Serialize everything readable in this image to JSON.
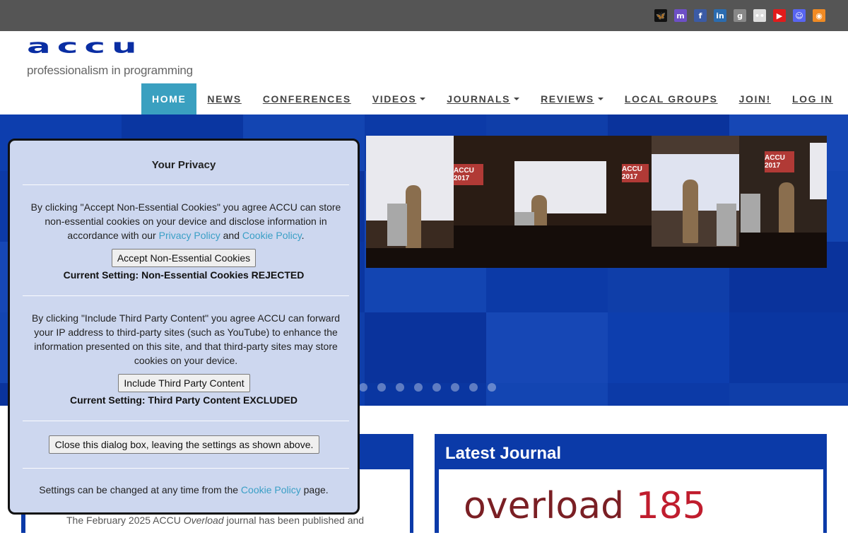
{
  "social": {
    "icons": [
      {
        "name": "bluesky-icon",
        "glyph": "🦋",
        "color": "#111111"
      },
      {
        "name": "mastodon-icon",
        "glyph": "m",
        "color": "#6d4fc6"
      },
      {
        "name": "facebook-icon",
        "glyph": "f",
        "color": "#3b5ba5"
      },
      {
        "name": "linkedin-icon",
        "glyph": "in",
        "color": "#2b6cb0"
      },
      {
        "name": "goodreads-icon",
        "glyph": "g",
        "color": "#888888"
      },
      {
        "name": "flickr-icon",
        "glyph": "••",
        "color": "#dddddd"
      },
      {
        "name": "youtube-icon",
        "glyph": "▶",
        "color": "#e21b1b"
      },
      {
        "name": "discord-icon",
        "glyph": "☺",
        "color": "#5865f2"
      },
      {
        "name": "rss-icon",
        "glyph": "◉",
        "color": "#f08a24"
      }
    ]
  },
  "brand": {
    "logo": "accu",
    "tagline": "professionalism in programming"
  },
  "nav": {
    "items": [
      {
        "label": "HOME",
        "active": true,
        "dropdown": false
      },
      {
        "label": "NEWS",
        "active": false,
        "dropdown": false
      },
      {
        "label": "CONFERENCES",
        "active": false,
        "dropdown": false
      },
      {
        "label": "VIDEOS",
        "active": false,
        "dropdown": true
      },
      {
        "label": "JOURNALS",
        "active": false,
        "dropdown": true
      },
      {
        "label": "REVIEWS",
        "active": false,
        "dropdown": true
      },
      {
        "label": "LOCAL GROUPS",
        "active": false,
        "dropdown": false
      },
      {
        "label": "JOIN!",
        "active": false,
        "dropdown": false
      },
      {
        "label": "LOG IN",
        "active": false,
        "dropdown": false
      }
    ]
  },
  "hero": {
    "sign_text": "ACCU 2017",
    "carousel_dot_count": 8
  },
  "privacy": {
    "title": "Your Privacy",
    "cookies_text_before": "By clicking \"Accept Non-Essential Cookies\" you agree ACCU can store non-essential cookies on your device and disclose information in accordance with our ",
    "privacy_policy_link": "Privacy Policy",
    "and_text": " and ",
    "cookie_policy_link": "Cookie Policy",
    "period": ".",
    "accept_button": "Accept Non-Essential Cookies",
    "cookies_setting": "Current Setting: Non-Essential Cookies REJECTED",
    "third_party_text": "By clicking \"Include Third Party Content\" you agree ACCU can forward your IP address to third-party sites (such as YouTube) to enhance the information presented on this site, and that third-party sites may store cookies on your device.",
    "include_button": "Include Third Party Content",
    "third_party_setting": "Current Setting: Third Party Content EXCLUDED",
    "close_button": "Close this dialog box, leaving the settings as shown above.",
    "footer_before": "Settings can be changed at any time from the ",
    "footer_link": "Cookie Policy",
    "footer_after": " page."
  },
  "news_panel": {
    "snippet_before": "The February 2025 ACCU ",
    "snippet_italic": "Overload",
    "snippet_after": " journal has been published and"
  },
  "journal_panel": {
    "title": "Latest Journal",
    "cover_word": "overload",
    "cover_number": "185"
  }
}
